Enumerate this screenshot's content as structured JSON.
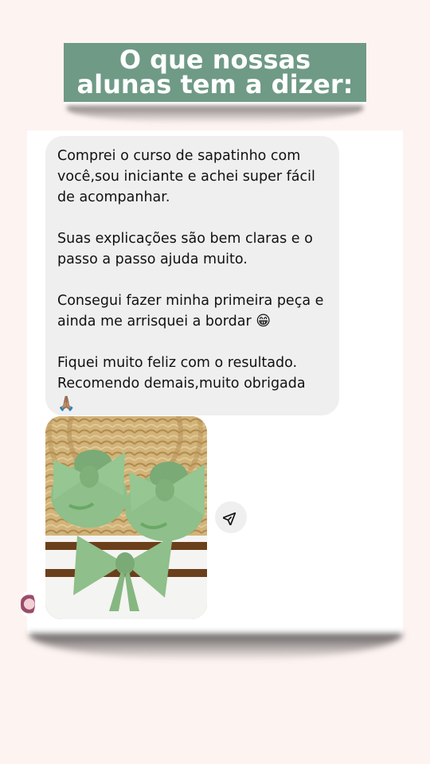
{
  "header": {
    "title_line1": "O que nossas",
    "title_line2": "alunas tem a dizer:"
  },
  "message": {
    "paragraphs": [
      "Comprei o curso de sapatinho com você,sou iniciante e achei super fácil de acompanhar.",
      "Suas explicações são bem claras e o passo a passo ajuda muito.",
      "Consegui fazer minha primeira peça e ainda me arrisquei a bordar",
      "Fiquei muito feliz com o resultado. Recomendo demais,muito obrigada"
    ],
    "emoji_smile": "😁",
    "emoji_pray": "🙏🏽"
  },
  "icons": {
    "share": "paper-plane-icon",
    "avatar": "avatar"
  },
  "colors": {
    "background": "#fdf3f1",
    "banner": "#6f9a86",
    "bubble": "#efefef",
    "bow_green": "#8fbf8a"
  }
}
